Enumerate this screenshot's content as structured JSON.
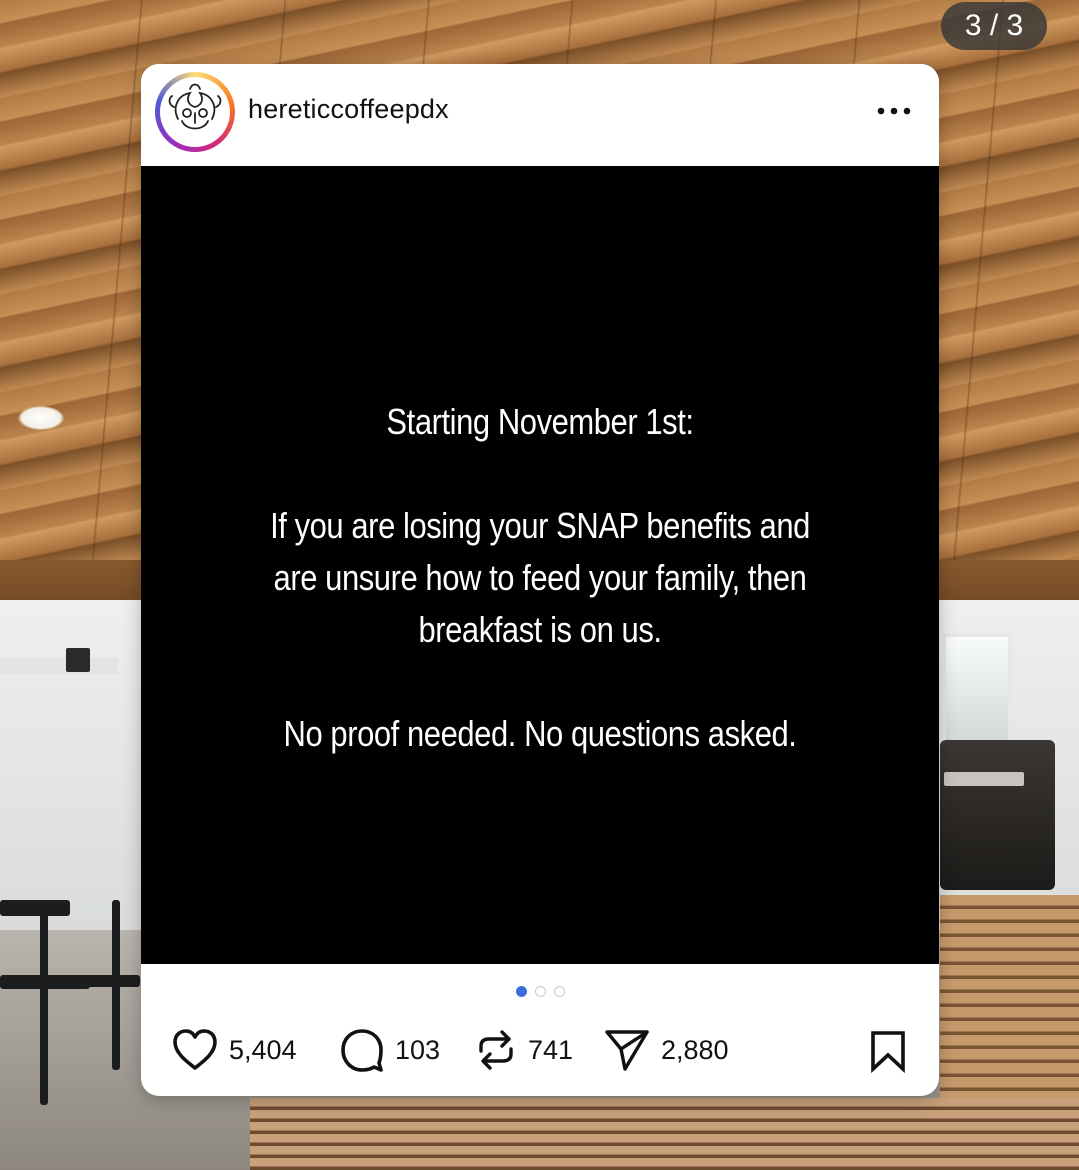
{
  "carousel": {
    "position_label": "3 / 3"
  },
  "post": {
    "username": "hereticcoffeepdx",
    "headline": "Starting November 1st:",
    "body": [
      "If you are losing your SNAP benefits and",
      "are unsure how to feed your family, then",
      "breakfast is on us."
    ],
    "footer_line": "No proof needed. No questions asked.",
    "pagination": {
      "total": 3,
      "active_index": 0
    }
  },
  "actions": {
    "likes": "5,404",
    "comments": "103",
    "reposts": "741",
    "shares": "2,880"
  },
  "icons": {
    "like": "heart-icon",
    "comment": "comment-icon",
    "repost": "repost-icon",
    "share": "send-icon",
    "save": "bookmark-icon",
    "more": "more-options-icon"
  },
  "colors": {
    "pagination_active": "#3b6fe0",
    "media_background": "#000000",
    "counter_badge": "#373737"
  }
}
